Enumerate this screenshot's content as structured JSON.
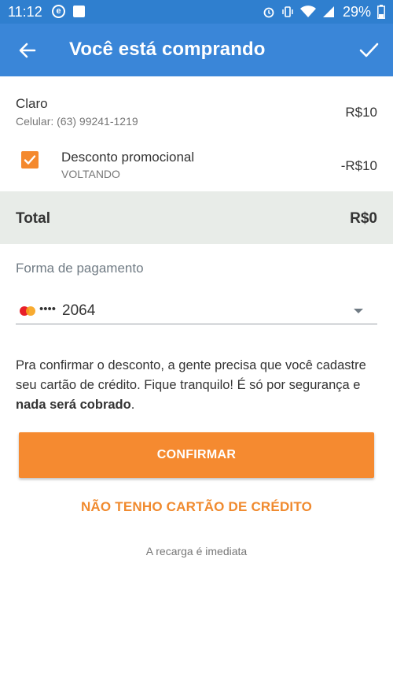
{
  "status_bar": {
    "time": "11:12",
    "battery_percent": "29%",
    "icons": [
      "e-circle-icon",
      "image-icon",
      "alarm-icon",
      "vibrate-icon",
      "wifi-icon",
      "signal-icon",
      "battery-icon"
    ]
  },
  "app_bar": {
    "title": "Você está comprando",
    "back_icon": "back-arrow-icon",
    "confirm_icon": "check-icon",
    "color": "#3a86d8"
  },
  "purchase": {
    "operator": "Claro",
    "phone": "Celular: (63) 99241-1219",
    "price": "R$10"
  },
  "discount": {
    "checked": true,
    "label": "Desconto promocional",
    "code": "VOLTANDO",
    "value": "-R$10"
  },
  "total": {
    "label": "Total",
    "value": "R$0"
  },
  "payment": {
    "label": "Forma de pagamento",
    "card_masked_dots": "••••",
    "card_last_digits": "2064",
    "card_brand_icon": "mastercard-icon"
  },
  "info_text": {
    "before_bold": "Pra confirmar o desconto, a gente precisa que você cadastre seu cartão de crédito. Fique tranquilo! É só por segurança e ",
    "bold": "nada será cobrado",
    "after_bold": "."
  },
  "actions": {
    "confirm_label": "CONFIRMAR",
    "no_card_label": "NÃO TENHO CARTÃO DE CRÉDITO",
    "accent_color": "#f58a30"
  },
  "footer_note": "A recarga é imediata"
}
